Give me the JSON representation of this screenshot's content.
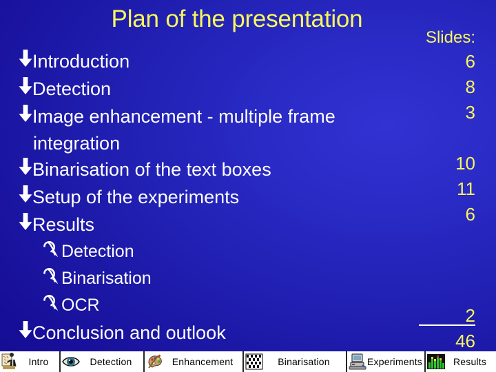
{
  "slide": {
    "title": "Plan of the presentation",
    "background_color_dark": "#130a8e",
    "background_color_light": "#3232d2",
    "title_color": "#f7f75c",
    "body_color": "#ffffff"
  },
  "slides_column": {
    "header": "Slides:",
    "counts": [
      "6",
      "8",
      "3",
      "10",
      "11",
      "6"
    ],
    "subtotal": "2",
    "total": "46"
  },
  "outline": [
    {
      "level": 1,
      "bullet": "down-arrow-bullet-icon",
      "text": "Introduction",
      "slides": "6"
    },
    {
      "level": 1,
      "bullet": "down-arrow-bullet-icon",
      "text": "Detection",
      "slides": "8"
    },
    {
      "level": 1,
      "bullet": "down-arrow-bullet-icon",
      "text": "Image enhancement - multiple frame",
      "slides": "3"
    },
    {
      "level": 1,
      "bullet": "none",
      "text": "integration",
      "slides": ""
    },
    {
      "level": 1,
      "bullet": "down-arrow-bullet-icon",
      "text": "Binarisation of the text boxes",
      "slides": "10"
    },
    {
      "level": 1,
      "bullet": "down-arrow-bullet-icon",
      "text": "Setup of the experiments",
      "slides": "11"
    },
    {
      "level": 1,
      "bullet": "down-arrow-bullet-icon",
      "text": "Results",
      "slides": "6"
    },
    {
      "level": 2,
      "bullet": "curved-arrow-bullet-icon",
      "text": "Detection",
      "slides": ""
    },
    {
      "level": 2,
      "bullet": "curved-arrow-bullet-icon",
      "text": "Binarisation",
      "slides": ""
    },
    {
      "level": 2,
      "bullet": "curved-arrow-bullet-icon",
      "text": "OCR",
      "slides": ""
    },
    {
      "level": 1,
      "bullet": "down-arrow-bullet-icon",
      "text": "Conclusion and outlook",
      "slides": "2"
    }
  ],
  "navbar": {
    "items": [
      {
        "label": "Intro",
        "icon": "presenter-flipchart-icon"
      },
      {
        "label": "Detection",
        "icon": "eye-icon"
      },
      {
        "label": "Enhancement",
        "icon": "artist-palette-icon"
      },
      {
        "label": "Binarisation",
        "icon": "binary-grid-icon"
      },
      {
        "label": "Experiments",
        "icon": "computer-workstation-icon"
      },
      {
        "label": "Results",
        "icon": "bar-chart-equalizer-icon"
      }
    ]
  }
}
